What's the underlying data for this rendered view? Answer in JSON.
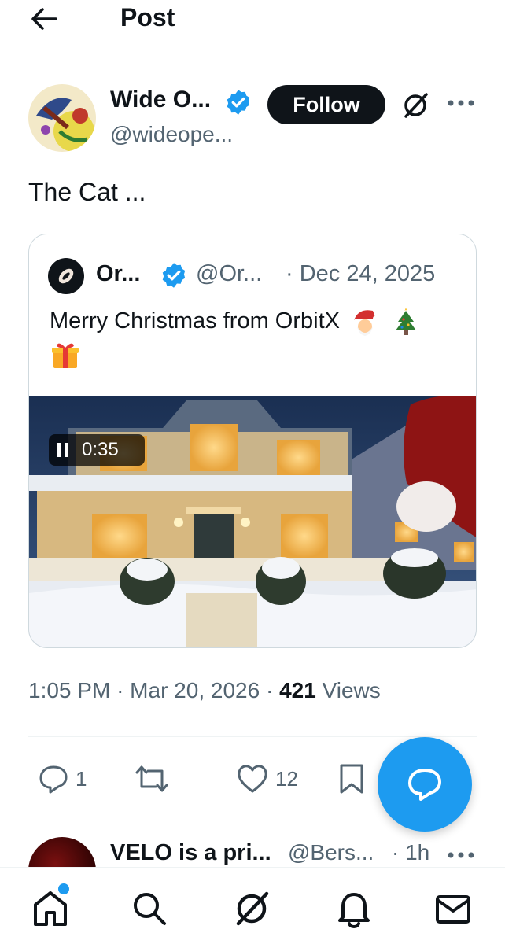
{
  "header": {
    "title": "Post"
  },
  "author": {
    "name": "Wide O...",
    "handle": "@wideope...",
    "follow_label": "Follow"
  },
  "post": {
    "text": "The Cat ..."
  },
  "quote": {
    "name": "Or...",
    "handle": "@Or...",
    "date": "· Dec 24, 2025",
    "text": "Merry Christmas from OrbitX",
    "emojis": [
      "santa-emoji",
      "christmas-tree-emoji",
      "gift-emoji"
    ],
    "video_time": "0:35"
  },
  "meta": {
    "time": "1:05 PM",
    "sep1": "·",
    "date": "Mar 20, 2026",
    "sep2": "·",
    "views_count": "421",
    "views_label": "Views"
  },
  "actions": {
    "replies": "1",
    "likes": "12"
  },
  "next_post": {
    "name": "VELO is a pri...",
    "handle": "@Bers...",
    "time": "· 1h"
  },
  "nav": {
    "items": [
      "home-icon",
      "search-icon",
      "grok-icon",
      "notifications-icon",
      "messages-icon"
    ],
    "home_badge": true
  },
  "colors": {
    "accent": "#1d9bf0",
    "text": "#0f1419",
    "secondary": "#536471",
    "border": "#cfd9de"
  }
}
